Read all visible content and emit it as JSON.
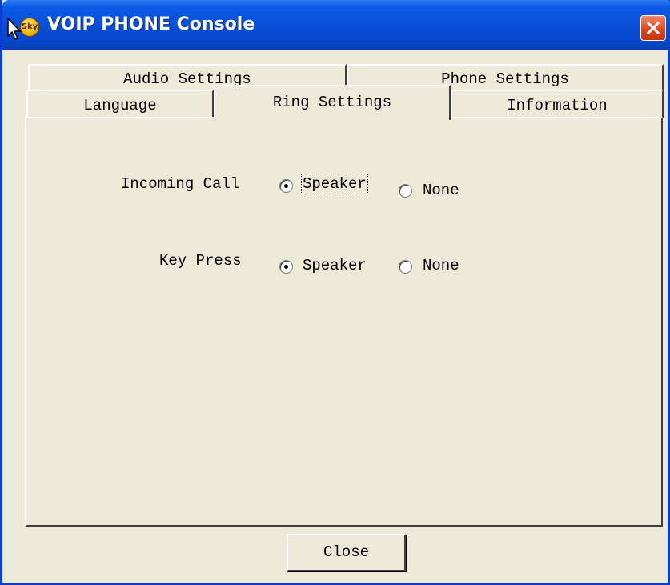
{
  "window": {
    "title": "VOIP PHONE Console",
    "icon_text": "Sky",
    "icon": "app-icon",
    "close_icon": "close-icon"
  },
  "tabs": {
    "row1": [
      {
        "label": "Audio Settings"
      },
      {
        "label": "Phone Settings"
      }
    ],
    "row2": [
      {
        "label": "Language"
      },
      {
        "label": "Ring Settings",
        "active": true
      },
      {
        "label": "Information"
      }
    ]
  },
  "ring_settings": {
    "incoming_call": {
      "label": "Incoming Call",
      "options": [
        "Speaker",
        "None"
      ],
      "selected": "Speaker"
    },
    "key_press": {
      "label": "Key Press",
      "options": [
        "Speaker",
        "None"
      ],
      "selected": "Speaker"
    }
  },
  "footer": {
    "close_label": "Close"
  },
  "colors": {
    "title_blue": "#0a4fd8",
    "face": "#ece9d8",
    "close_red": "#d9481e"
  }
}
